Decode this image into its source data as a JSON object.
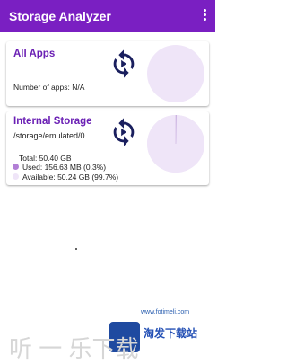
{
  "app": {
    "title": "Storage Analyzer",
    "accent": "#7a1fc2"
  },
  "all_apps": {
    "title": "All Apps",
    "count_text": "Number of apps: N/A"
  },
  "internal": {
    "title": "Internal Storage",
    "path": "/storage/emulated/0",
    "total": "Total: 50.40 GB",
    "used": "Used: 156.63 MB (0.3%)",
    "available": "Available: 50.24 GB (99.7%)",
    "used_fraction": 0.003,
    "used_color": "#b27fd6",
    "available_color": "#efe5f8"
  },
  "icons": {
    "refresh_apps": "sync-icon",
    "refresh_internal": "sync-icon",
    "menu": "more-vert-icon"
  },
  "watermark": {
    "site": "www.fotimeli.com",
    "logo_text": "淘发下载站",
    "faded_text": "听 一 乐下载"
  }
}
